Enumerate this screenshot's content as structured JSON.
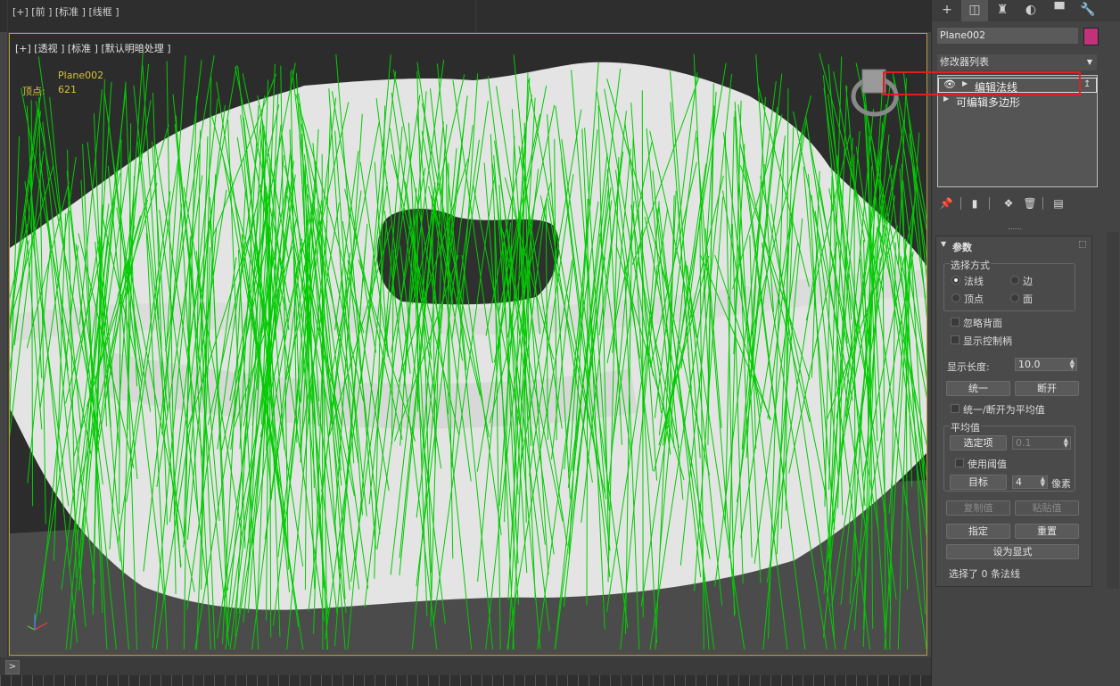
{
  "top_viewport": {
    "label": "[+] [前 ] [标准 ] [线框 ]"
  },
  "perspective_viewport": {
    "label": "[+] [透视 ] [标准 ] [默认明暗处理 ]",
    "stats": {
      "object_name": "Plane002",
      "vertex_label": "顶点:",
      "vertex_value": "621"
    },
    "normals_color": "#00cc00",
    "mesh_color": "#e6e6e6"
  },
  "bottom": {
    "expand_label": ">"
  },
  "command_panel": {
    "tabs": [
      {
        "icon": "plus-icon",
        "glyph": "+"
      },
      {
        "icon": "modify-icon",
        "glyph": "◫"
      },
      {
        "icon": "hierarchy-icon",
        "glyph": "♜"
      },
      {
        "icon": "motion-icon",
        "glyph": "◐"
      },
      {
        "icon": "display-icon",
        "glyph": "▀"
      },
      {
        "icon": "utilities-icon",
        "glyph": "🔧"
      }
    ],
    "object_name": "Plane002",
    "object_color": "#c0337a",
    "modifier_list": "修改器列表",
    "stack": [
      {
        "label": "编辑法线",
        "selected": true
      },
      {
        "label": "可编辑多边形",
        "selected": false
      }
    ],
    "rollout": {
      "title": "参数",
      "selection_group": "选择方式",
      "radio_normal": "法线",
      "radio_edge": "边",
      "radio_vertex": "顶点",
      "radio_face": "面",
      "selected_mode": "法线",
      "ignore_backfacing": "忽略背面",
      "show_handles": "显示控制柄",
      "display_length_label": "显示长度:",
      "display_length_value": "10.0",
      "unify_button": "统一",
      "break_button": "断开",
      "unify_break_to_average": "统一/断开为平均值",
      "average_group": "平均值",
      "selected_button": "选定项",
      "selected_value": "0.1",
      "use_threshold": "使用阈值",
      "target_button": "目标",
      "target_value": "4",
      "pixels_label": "像素",
      "copy_value_button": "复制值",
      "paste_value_button": "粘贴值",
      "specify_button": "指定",
      "reset_button": "重置",
      "make_explicit_button": "设为显式",
      "status_text": "选择了 0 条法线"
    }
  }
}
